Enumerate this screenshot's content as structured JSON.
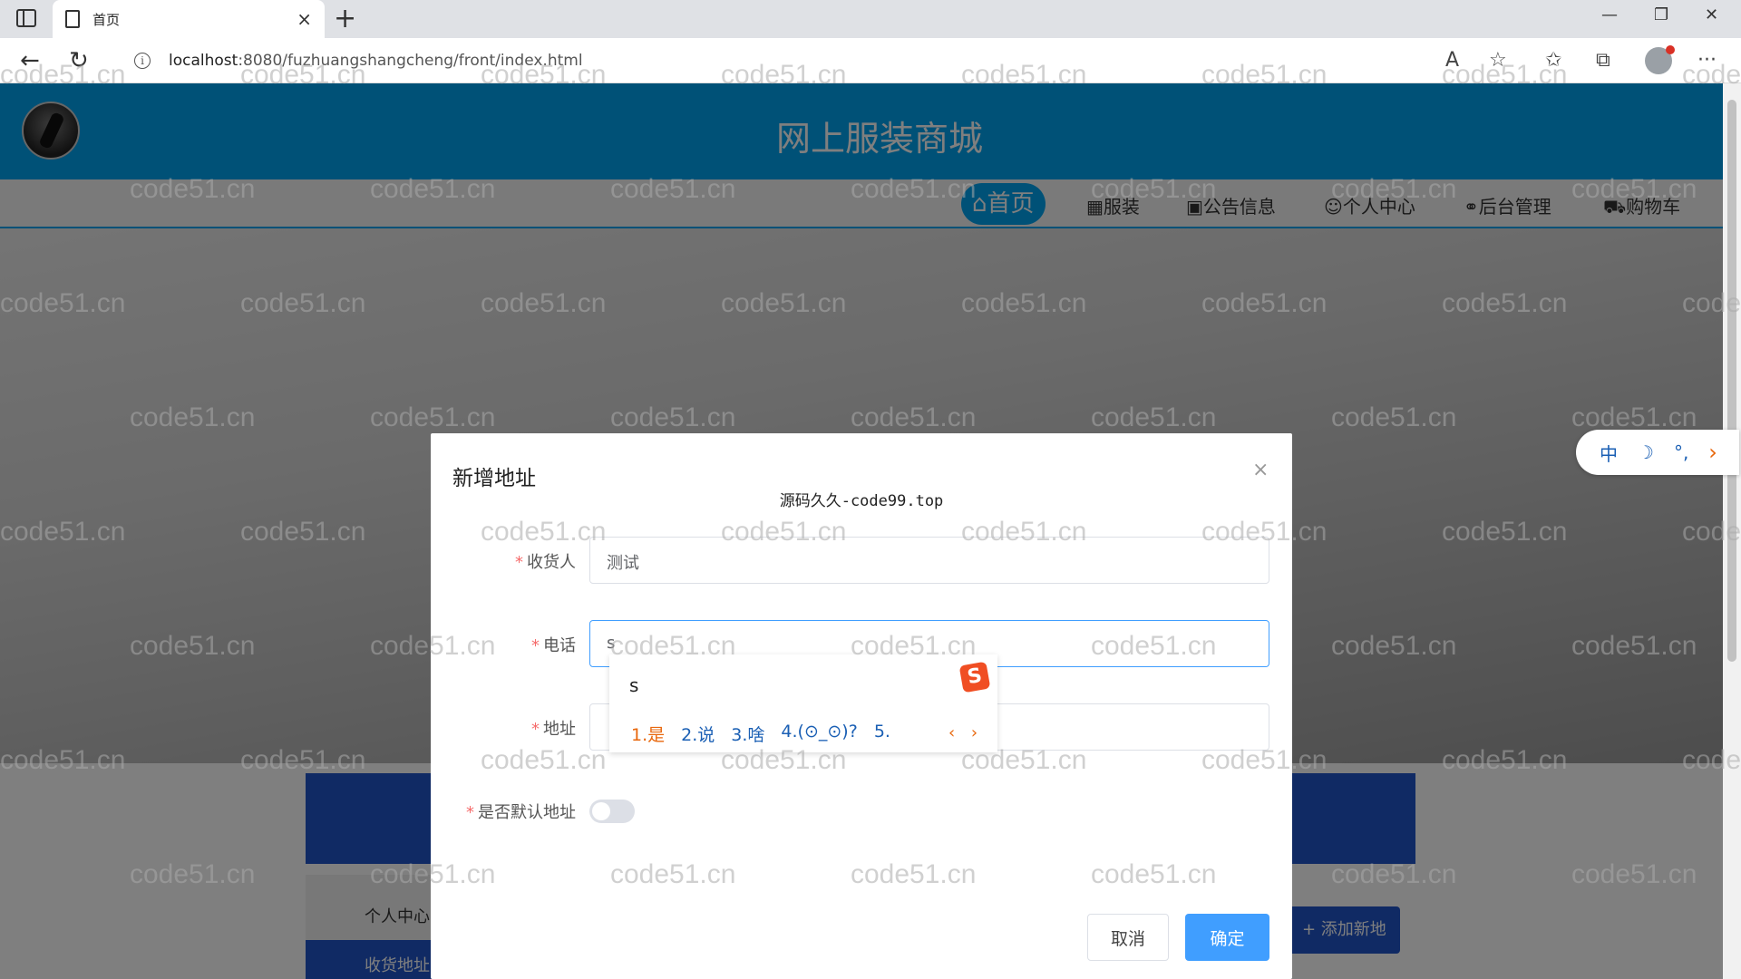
{
  "browser": {
    "tab_title": "首页",
    "tab_close": "×",
    "new_tab": "+",
    "win_min": "—",
    "win_restore": "❐",
    "win_close": "✕",
    "url_host": "localhost",
    "url_rest": ":8080/fuzhuangshangcheng/front/index.html",
    "info_glyph": "i",
    "back_glyph": "←",
    "reload_glyph": "↻",
    "read_aloud_glyph": "A",
    "favorite_add_glyph": "☆",
    "favorites_glyph": "✩",
    "collections_glyph": "⧉",
    "menu_glyph": "···"
  },
  "site": {
    "title": "网上服装商城",
    "nav": [
      {
        "icon": "⌂",
        "label": "首页"
      },
      {
        "icon": "▦",
        "label": "服装"
      },
      {
        "icon": "▣",
        "label": "公告信息"
      },
      {
        "icon": "☺",
        "label": "个人中心"
      },
      {
        "icon": "⚭",
        "label": "后台管理"
      },
      {
        "icon": "⛟",
        "label": "购物车"
      }
    ]
  },
  "underlying": {
    "side_item_1": "个人中心",
    "side_item_2": "收货地址",
    "add_address_button": "+ 添加新地址"
  },
  "dialog": {
    "title": "新增地址",
    "close_glyph": "×",
    "subtitle": "源码久久-code99.top",
    "fields": {
      "receiver_label": "收货人",
      "receiver_value": "测试",
      "phone_label": "电话",
      "phone_value": "s",
      "address_label": "地址",
      "address_value": "",
      "default_label": "是否默认地址"
    },
    "required_mark": "*",
    "cancel": "取消",
    "confirm": "确定"
  },
  "ime": {
    "typed": "s",
    "logo": "S",
    "candidates": [
      "1.是",
      "2.说",
      "3.啥",
      "4.(⊙_⊙)?",
      "5."
    ],
    "pager": "‹ ›",
    "bar": [
      "中",
      "☽",
      "°,",
      "›"
    ]
  },
  "watermark": "code51.cn"
}
